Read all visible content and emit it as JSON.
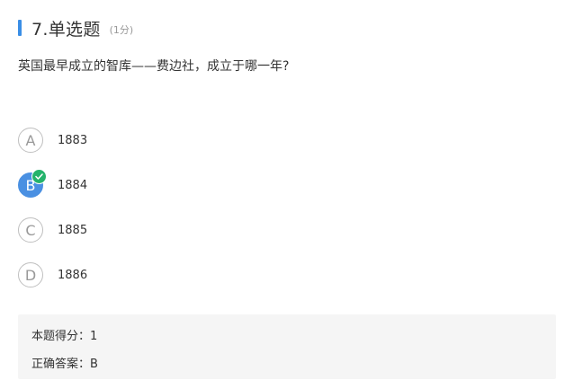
{
  "question": {
    "number_type": "7.单选题",
    "score": "(1分)",
    "stem": "英国最早成立的智库——费边社，成立于哪一年?"
  },
  "options": [
    {
      "letter": "A",
      "text": "1883",
      "selected": false
    },
    {
      "letter": "B",
      "text": "1884",
      "selected": true
    },
    {
      "letter": "C",
      "text": "1885",
      "selected": false
    },
    {
      "letter": "D",
      "text": "1886",
      "selected": false
    }
  ],
  "result": {
    "score_line": "本题得分：1",
    "answer_line": "正确答案：B"
  },
  "colors": {
    "accent": "#3a8ee6",
    "selected": "#4a90e2",
    "correct": "#24b36b",
    "panel": "#f5f5f5"
  },
  "icons": {
    "correct": "check-icon"
  }
}
